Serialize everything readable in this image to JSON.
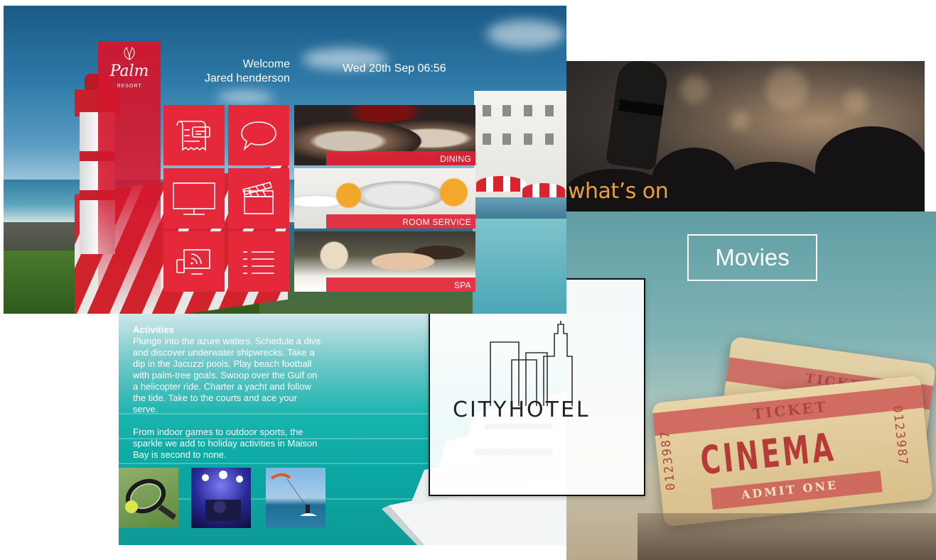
{
  "palm_screen": {
    "logo": {
      "wordmark": "Palm",
      "sub": "RESORT",
      "icon": "palm-leaf-icon"
    },
    "welcome_line1": "Welcome",
    "welcome_line2": "Jared henderson",
    "datetime": "Wed 20th Sep 06:56",
    "icon_tiles": [
      {
        "name": "bill",
        "icon": "receipt-icon"
      },
      {
        "name": "messages",
        "icon": "chat-bubble-icon"
      },
      {
        "name": "tv",
        "icon": "tv-icon"
      },
      {
        "name": "movies",
        "icon": "clapperboard-icon"
      },
      {
        "name": "cast",
        "icon": "cast-icon"
      },
      {
        "name": "menu",
        "icon": "list-icon"
      }
    ],
    "photo_tiles": [
      {
        "label": "DINING"
      },
      {
        "label": "ROOM SERVICE"
      },
      {
        "label": "SPA"
      }
    ],
    "colors": {
      "brand_red": "#e5283a"
    }
  },
  "activities": {
    "title": "Activities",
    "paragraph1": "Plunge into the azure waters. Schedule a dive and discover underwater shipwrecks. Take a dip in the Jacuzzi pools. Play beach football with palm-tree goals. Swoop over the Gulf on a helicopter ride. Charter a yacht and follow the tide. Take to the courts and ace your serve.",
    "paragraph2": "From indoor games to outdoor sports, the sparkle we add to holiday activities in Maison Bay is second to none.",
    "thumbnails": [
      "tennis",
      "concert",
      "kitesurf"
    ]
  },
  "city_hotel": {
    "name": "CITYHOTEL"
  },
  "whats_on": {
    "title": "what’s on"
  },
  "movies": {
    "title": "Movies",
    "ticket": {
      "top": "TICKET",
      "main": "CINEMA",
      "bottom": "ADMIT ONE",
      "serial": "0123987"
    }
  }
}
